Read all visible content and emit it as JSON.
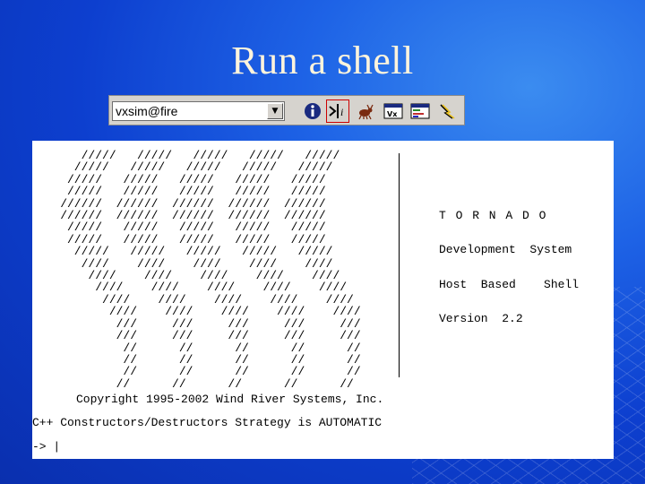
{
  "slide": {
    "title": "Run a shell"
  },
  "toolbar": {
    "target_value": "vxsim@fire",
    "buttons": [
      {
        "name": "info-icon"
      },
      {
        "name": "shell-icon"
      },
      {
        "name": "debugger-icon"
      },
      {
        "name": "vxworks-icon"
      },
      {
        "name": "browser-icon"
      },
      {
        "name": "windview-icon"
      }
    ]
  },
  "terminal": {
    "logo_lines": [
      "       /////   /////   /////   /////   /////",
      "      /////   /////   /////   /////   /////",
      "     /////   /////   /////   /////   /////",
      "     /////   /////   /////   /////   /////",
      "    //////  //////  //////  //////  //////",
      "    //////  //////  //////  //////  //////",
      "     /////   /////   /////   /////   /////",
      "     /////   /////   /////   /////   /////",
      "      /////   /////   /////   /////   /////",
      "       ////    ////    ////    ////    ////",
      "        ////    ////    ////    ////    ////",
      "         ////    ////    ////    ////    ////",
      "          ////    ////    ////    ////    ////",
      "           ////    ////    ////    ////    ////",
      "            ///     ///     ///     ///     ///",
      "            ///     ///     ///     ///     ///",
      "             //      //      //      //      //",
      "             //      //      //      //      //",
      "             //      //      //      //      //",
      "            //      //      //      //      //"
    ],
    "product_name": "T O R N A D O",
    "product_line1": "Development  System",
    "product_line2": "Host  Based    Shell",
    "version": "Version  2.2",
    "copyright": "Copyright 1995-2002 Wind River Systems, Inc.",
    "constructors": "C++ Constructors/Destructors Strategy is AUTOMATIC",
    "prompt": "-> |"
  }
}
